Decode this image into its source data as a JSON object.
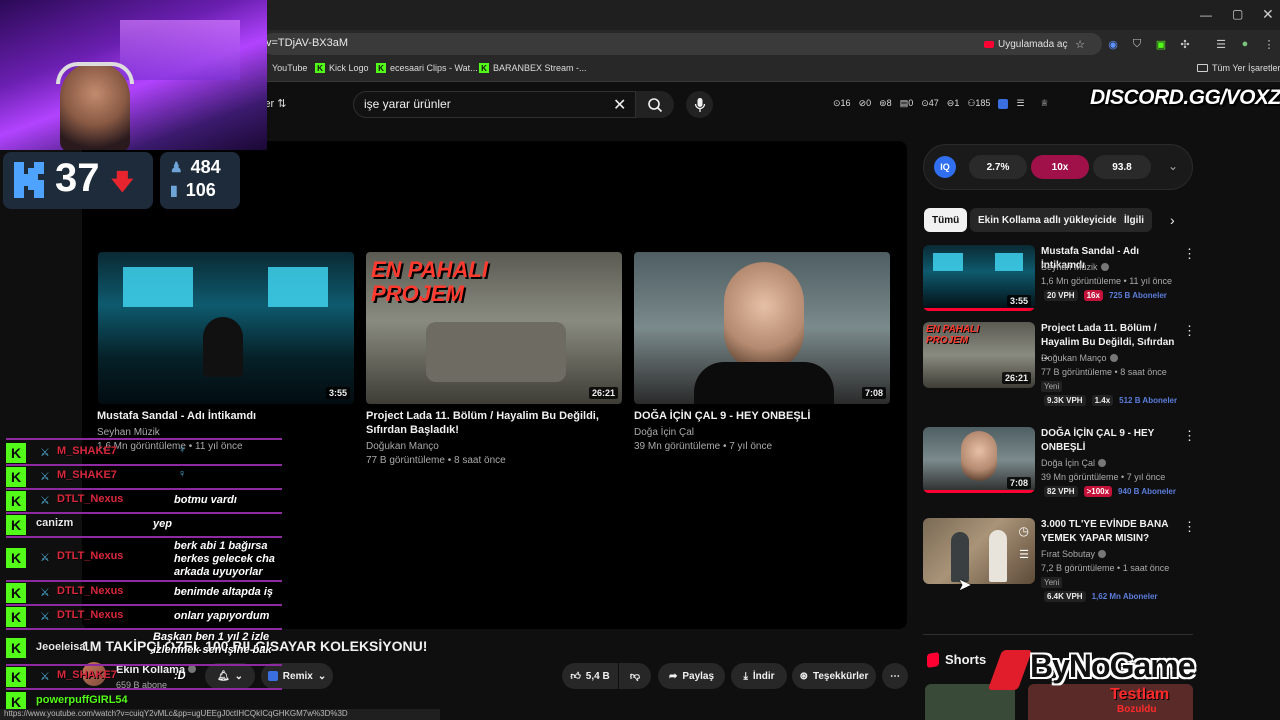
{
  "browser": {
    "url_fragment": "v=TDjAV-BX3aM",
    "app_button_label": "Uygulamada aç",
    "bookmarks": [
      {
        "label": "YouTube",
        "icon": "youtube-icon"
      },
      {
        "label": "Kick Logo",
        "icon": "kick-icon"
      },
      {
        "label": "ecesaari Clips - Wat...",
        "icon": "kick-icon"
      },
      {
        "label": "BARANBEX Stream -...",
        "icon": "kick-icon"
      }
    ],
    "all_bookmarks_label": "Tüm Yer İşaretleri"
  },
  "youtube": {
    "filter_label": "ler",
    "search_value": "işe yarar ürünler",
    "ext_stats": [
      "16",
      "0",
      "8",
      "0",
      "47",
      "1",
      "185"
    ],
    "end_cards": [
      {
        "title": "Mustafa Sandal - Adı İntikamdı",
        "channel": "Seyhan Müzik",
        "meta": "1,6 Mn görüntüleme • 11 yıl önce",
        "duration": "3:55"
      },
      {
        "title": "Project Lada 11. Bölüm / Hayalim Bu Değildi, Sıfırdan Başladık!",
        "channel": "Doğukan Manço",
        "meta": "77 B görüntüleme • 8 saat önce",
        "duration": "26:21",
        "overlay_text": "EN PAHALI PROJEM"
      },
      {
        "title": "DOĞA İÇİN ÇAL 9 - HEY ONBEŞLİ",
        "channel": "Doğa İçin Çal",
        "meta": "39 Mn görüntüleme • 7 yıl önce",
        "duration": "7:08"
      }
    ],
    "video_title": "1M TAKİPÇİ ÖZEL 100 BİLGİSAYAR KOLEKSİYONU!",
    "channel_name": "Ekin Kollama",
    "subscribers": "659 B abone",
    "actions": {
      "remix": "Remix",
      "likes": "5,4 B",
      "share": "Paylaş",
      "download": "İndir",
      "thanks": "Teşekkürler"
    },
    "vph_panel": {
      "iq": "IQ",
      "percent": "2.7%",
      "multiplier": "10x",
      "score": "93.8"
    },
    "chips": [
      "Tümü",
      "Ekin Kollama adlı yükleyiciden",
      "İlgili"
    ],
    "related": [
      {
        "title": "Mustafa Sandal - Adı İntikamdı",
        "channel": "Seyhan Müzik",
        "meta": "1,6 Mn görüntüleme • 11 yıl önce",
        "duration": "3:55",
        "vph": "20 VPH",
        "mult": "16x",
        "subs": "725 B Aboneler",
        "is_new": false
      },
      {
        "title": "Project Lada 11. Bölüm / Hayalim Bu Değildi, Sıfırdan ...",
        "channel": "Doğukan Manço",
        "meta": "77 B görüntüleme • 8 saat önce",
        "duration": "26:21",
        "new_label": "Yeni",
        "vph": "9.3K VPH",
        "mult": "1.4x",
        "subs": "512 B Aboneler",
        "is_new": true,
        "overlay_text": "EN PAHALI PROJEM"
      },
      {
        "title": "DOĞA İÇİN ÇAL 9 - HEY ONBEŞLİ",
        "channel": "Doğa İçin Çal",
        "meta": "39 Mn görüntüleme • 7 yıl önce",
        "duration": "7:08",
        "vph": "82 VPH",
        "mult": ">100x",
        "subs": "940 B Aboneler",
        "is_new": false
      },
      {
        "title": "3.000 TL'YE EVİNDE BANA YEMEK YAPAR MISIN?",
        "channel": "Fırat Sobutay",
        "meta": "7,2 B görüntüleme • 1 saat önce",
        "new_label": "Yeni",
        "vph": "6.4K VPH",
        "subs": "1,62 Mn Aboneler",
        "is_new": true
      }
    ],
    "shorts_label": "Shorts"
  },
  "overlays": {
    "discord": "DISCORD.GG/VOXZ",
    "kick_rank": "37",
    "kick_viewers": "484",
    "kick_followers": "106",
    "sponsor": "ByNoGame",
    "sponsor_sub": "Testlam",
    "sponsor_sub2": "Bozuldu"
  },
  "chat": [
    {
      "user": "M_SHAKE7",
      "msg": "",
      "color": "#d8273b",
      "sword": true
    },
    {
      "user": "M_SHAKE7",
      "msg": "",
      "color": "#d8273b",
      "sword": true
    },
    {
      "user": "DTLT_Nexus",
      "msg": "botmu vardı",
      "color": "#d8273b",
      "sword": true
    },
    {
      "user": "canizm",
      "msg": "yep",
      "color": "#e9e9e9",
      "sword": false
    },
    {
      "user": "DTLT_Nexus",
      "msg": "berk abi 1 bağırsa herkes gelecek cha arkada uyuyorlar",
      "color": "#d8273b",
      "sword": true
    },
    {
      "user": "DTLT_Nexus",
      "msg": "benimde altapda iş",
      "color": "#d8273b",
      "sword": true
    },
    {
      "user": "DTLT_Nexus",
      "msg": "onları yapıyordum",
      "color": "#d8273b",
      "sword": true
    },
    {
      "user": "Jeoeleisa",
      "msg": "Başkan ben 1 yıl 2 izle izlenmek sen işine bak",
      "color": "#e9e9e9",
      "sword": false
    },
    {
      "user": "M_SHAKE7",
      "msg": ":D",
      "color": "#d8273b",
      "sword": true
    },
    {
      "user": "powerpuffGIRL54",
      "msg": "",
      "color": "#53fc18",
      "sword": false
    }
  ],
  "status_bar_url": "https://www.youtube.com/watch?v=cuiqY2vMLc&pp=ugUEEgJ0ctIHCQkICqGHKGM7w%3D%3D",
  "colors": {
    "background": "#0f0f0f",
    "kick_green": "#53fc18",
    "chat_border": "#8d2aa0",
    "accent_red": "#c4123b",
    "iq_blue": "#2f6ff0"
  }
}
